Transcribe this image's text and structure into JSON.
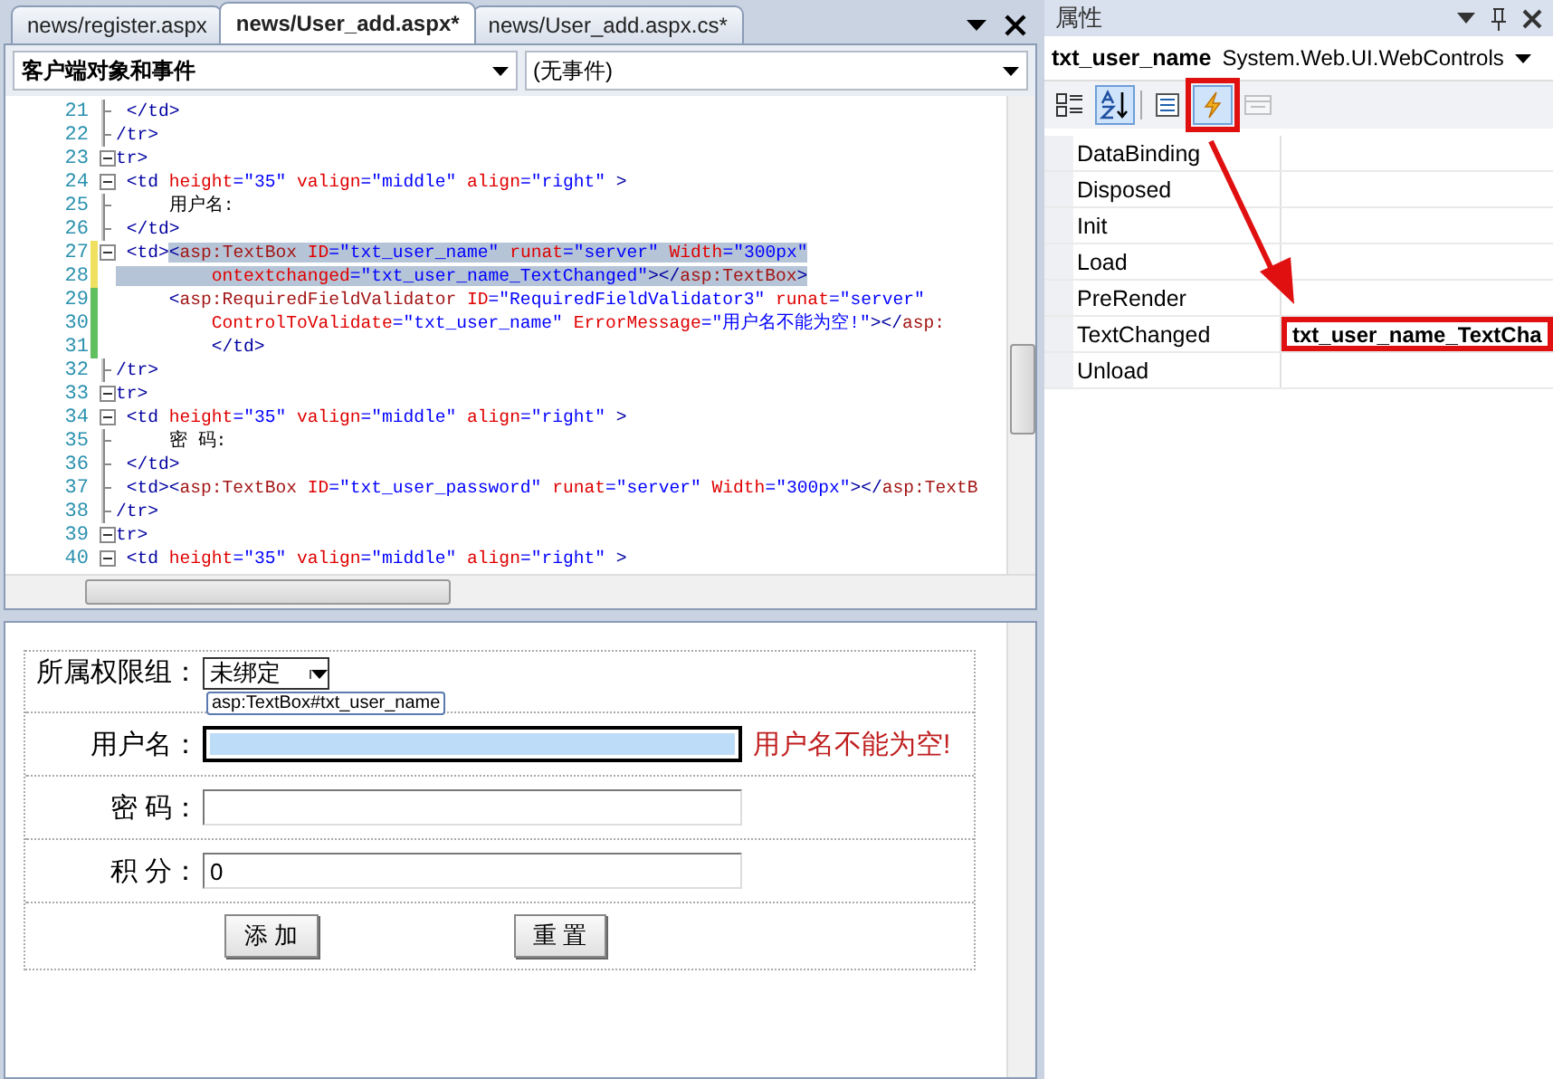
{
  "editor": {
    "tabs": [
      {
        "label": "news/register.aspx",
        "selected": false
      },
      {
        "label": "news/User_add.aspx*",
        "selected": true
      },
      {
        "label": "news/User_add.aspx.cs*",
        "selected": false
      }
    ],
    "object_dropdown": "客户端对象和事件",
    "event_dropdown": "(无事件)",
    "code_lines": [
      {
        "number": "21",
        "collapsible": false,
        "guide": true,
        "edited": false,
        "saved": false,
        "tokens": [
          {
            "kind": "tag",
            "text": " </td>",
            "selected": false
          }
        ]
      },
      {
        "number": "22",
        "collapsible": false,
        "guide": true,
        "edited": false,
        "saved": false,
        "tokens": [
          {
            "kind": "tag",
            "text": "/tr>",
            "selected": false
          }
        ]
      },
      {
        "number": "23",
        "collapsible": true,
        "guide": false,
        "edited": false,
        "saved": false,
        "tokens": [
          {
            "kind": "tag",
            "text": "tr>",
            "selected": false
          }
        ]
      },
      {
        "number": "24",
        "collapsible": true,
        "guide": false,
        "edited": false,
        "saved": false,
        "tokens": [
          {
            "kind": "tag",
            "text": " <td ",
            "selected": false
          },
          {
            "kind": "attr",
            "text": "height",
            "selected": false
          },
          {
            "kind": "value",
            "text": "=\"35\" ",
            "selected": false
          },
          {
            "kind": "attr",
            "text": "valign",
            "selected": false
          },
          {
            "kind": "value",
            "text": "=\"middle\" ",
            "selected": false
          },
          {
            "kind": "attr",
            "text": "align",
            "selected": false
          },
          {
            "kind": "value",
            "text": "=\"right\" ",
            "selected": false
          },
          {
            "kind": "tag",
            "text": ">",
            "selected": false
          }
        ]
      },
      {
        "number": "25",
        "collapsible": false,
        "guide": true,
        "edited": false,
        "saved": false,
        "tokens": [
          {
            "kind": "text",
            "text": "     用户名:",
            "selected": false
          }
        ]
      },
      {
        "number": "26",
        "collapsible": false,
        "guide": true,
        "edited": false,
        "saved": false,
        "tokens": [
          {
            "kind": "tag",
            "text": " </td>",
            "selected": false
          }
        ]
      },
      {
        "number": "27",
        "collapsible": true,
        "guide": false,
        "edited": true,
        "saved": false,
        "tokens": [
          {
            "kind": "tag",
            "text": " <td>",
            "selected": false
          },
          {
            "kind": "tag",
            "text": "<",
            "selected": true
          },
          {
            "kind": "asp",
            "text": "asp:TextBox ",
            "selected": true
          },
          {
            "kind": "attr",
            "text": "ID",
            "selected": true
          },
          {
            "kind": "value",
            "text": "=\"txt_user_name\" ",
            "selected": true
          },
          {
            "kind": "attr",
            "text": "runat",
            "selected": true
          },
          {
            "kind": "value",
            "text": "=\"server\" ",
            "selected": true
          },
          {
            "kind": "attr",
            "text": "Width",
            "selected": true
          },
          {
            "kind": "value",
            "text": "=\"300px\"",
            "selected": true
          }
        ]
      },
      {
        "number": "28",
        "collapsible": false,
        "guide": false,
        "edited": true,
        "saved": false,
        "tokens": [
          {
            "kind": "attr",
            "text": "         ontextchanged",
            "selected": true
          },
          {
            "kind": "value",
            "text": "=\"txt_user_name_TextChanged\"",
            "selected": true
          },
          {
            "kind": "tag",
            "text": "></",
            "selected": true
          },
          {
            "kind": "asp",
            "text": "asp:TextBox",
            "selected": true
          },
          {
            "kind": "tag",
            "text": ">",
            "selected": true
          }
        ]
      },
      {
        "number": "29",
        "collapsible": false,
        "guide": false,
        "edited": false,
        "saved": true,
        "tokens": [
          {
            "kind": "tag",
            "text": "     <",
            "selected": false
          },
          {
            "kind": "asp",
            "text": "asp:RequiredFieldValidator ",
            "selected": false
          },
          {
            "kind": "attr",
            "text": "ID",
            "selected": false
          },
          {
            "kind": "value",
            "text": "=\"RequiredFieldValidator3\" ",
            "selected": false
          },
          {
            "kind": "attr",
            "text": "runat",
            "selected": false
          },
          {
            "kind": "value",
            "text": "=\"server\"",
            "selected": false
          }
        ]
      },
      {
        "number": "30",
        "collapsible": false,
        "guide": false,
        "edited": false,
        "saved": true,
        "tokens": [
          {
            "kind": "attr",
            "text": "         ControlToValidate",
            "selected": false
          },
          {
            "kind": "value",
            "text": "=\"txt_user_name\" ",
            "selected": false
          },
          {
            "kind": "attr",
            "text": "ErrorMessage",
            "selected": false
          },
          {
            "kind": "value",
            "text": "=\"用户名不能为空!\"",
            "selected": false
          },
          {
            "kind": "tag",
            "text": "></",
            "selected": false
          },
          {
            "kind": "asp",
            "text": "asp:",
            "selected": false
          }
        ]
      },
      {
        "number": "31",
        "collapsible": false,
        "guide": false,
        "edited": false,
        "saved": true,
        "tokens": [
          {
            "kind": "tag",
            "text": "         </td>",
            "selected": false
          }
        ]
      },
      {
        "number": "32",
        "collapsible": false,
        "guide": true,
        "edited": false,
        "saved": false,
        "tokens": [
          {
            "kind": "tag",
            "text": "/tr>",
            "selected": false
          }
        ]
      },
      {
        "number": "33",
        "collapsible": true,
        "guide": false,
        "edited": false,
        "saved": false,
        "tokens": [
          {
            "kind": "tag",
            "text": "tr>",
            "selected": false
          }
        ]
      },
      {
        "number": "34",
        "collapsible": true,
        "guide": false,
        "edited": false,
        "saved": false,
        "tokens": [
          {
            "kind": "tag",
            "text": " <td ",
            "selected": false
          },
          {
            "kind": "attr",
            "text": "height",
            "selected": false
          },
          {
            "kind": "value",
            "text": "=\"35\" ",
            "selected": false
          },
          {
            "kind": "attr",
            "text": "valign",
            "selected": false
          },
          {
            "kind": "value",
            "text": "=\"middle\" ",
            "selected": false
          },
          {
            "kind": "attr",
            "text": "align",
            "selected": false
          },
          {
            "kind": "value",
            "text": "=\"right\" ",
            "selected": false
          },
          {
            "kind": "tag",
            "text": ">",
            "selected": false
          }
        ]
      },
      {
        "number": "35",
        "collapsible": false,
        "guide": true,
        "edited": false,
        "saved": false,
        "tokens": [
          {
            "kind": "text",
            "text": "     密 码:",
            "selected": false
          }
        ]
      },
      {
        "number": "36",
        "collapsible": false,
        "guide": true,
        "edited": false,
        "saved": false,
        "tokens": [
          {
            "kind": "tag",
            "text": " </td>",
            "selected": false
          }
        ]
      },
      {
        "number": "37",
        "collapsible": false,
        "guide": true,
        "edited": false,
        "saved": false,
        "tokens": [
          {
            "kind": "tag",
            "text": " <td><",
            "selected": false
          },
          {
            "kind": "asp",
            "text": "asp:TextBox ",
            "selected": false
          },
          {
            "kind": "attr",
            "text": "ID",
            "selected": false
          },
          {
            "kind": "value",
            "text": "=\"txt_user_password\" ",
            "selected": false
          },
          {
            "kind": "attr",
            "text": "runat",
            "selected": false
          },
          {
            "kind": "value",
            "text": "=\"server\" ",
            "selected": false
          },
          {
            "kind": "attr",
            "text": "Width",
            "selected": false
          },
          {
            "kind": "value",
            "text": "=\"300px\"",
            "selected": false
          },
          {
            "kind": "tag",
            "text": "></",
            "selected": false
          },
          {
            "kind": "asp",
            "text": "asp:TextB",
            "selected": false
          }
        ]
      },
      {
        "number": "38",
        "collapsible": false,
        "guide": true,
        "edited": false,
        "saved": false,
        "tokens": [
          {
            "kind": "tag",
            "text": "/tr>",
            "selected": false
          }
        ]
      },
      {
        "number": "39",
        "collapsible": true,
        "guide": false,
        "edited": false,
        "saved": false,
        "tokens": [
          {
            "kind": "tag",
            "text": "tr>",
            "selected": false
          }
        ]
      },
      {
        "number": "40",
        "collapsible": true,
        "guide": false,
        "edited": false,
        "saved": false,
        "tokens": [
          {
            "kind": "tag",
            "text": " <td ",
            "selected": false
          },
          {
            "kind": "attr",
            "text": "height",
            "selected": false
          },
          {
            "kind": "value",
            "text": "=\"35\" ",
            "selected": false
          },
          {
            "kind": "attr",
            "text": "valign",
            "selected": false
          },
          {
            "kind": "value",
            "text": "=\"middle\" ",
            "selected": false
          },
          {
            "kind": "attr",
            "text": "align",
            "selected": false
          },
          {
            "kind": "value",
            "text": "=\"right\" ",
            "selected": false
          },
          {
            "kind": "tag",
            "text": ">",
            "selected": false
          }
        ]
      }
    ]
  },
  "designer": {
    "control_tag": "asp:TextBox#txt_user_name",
    "rows": [
      {
        "label": "所属权限组：",
        "kind": "select",
        "value": "未绑定",
        "selected": false
      },
      {
        "label": "用户名：",
        "kind": "text",
        "value": "",
        "selected": true,
        "error": "用户名不能为空!"
      },
      {
        "label": "密 码：",
        "kind": "text",
        "value": "",
        "selected": false
      },
      {
        "label": "积 分：",
        "kind": "text",
        "value": "0",
        "selected": false
      }
    ],
    "buttons": [
      "添 加",
      "重 置"
    ]
  },
  "properties": {
    "title": "属性",
    "object_name": "txt_user_name",
    "object_type": "System.Web.UI.WebControls",
    "toolbar": [
      {
        "kind": "categorized",
        "selected": false,
        "disabled": false,
        "highlighted": false
      },
      {
        "kind": "alphabetical",
        "selected": true,
        "disabled": false,
        "highlighted": false
      },
      {
        "kind": "properties",
        "selected": false,
        "disabled": false,
        "highlighted": false
      },
      {
        "kind": "events",
        "selected": true,
        "disabled": false,
        "highlighted": true
      },
      {
        "kind": "pages",
        "selected": false,
        "disabled": true,
        "highlighted": false
      }
    ],
    "events": [
      {
        "name": "DataBinding",
        "highlighted": false
      },
      {
        "name": "Disposed",
        "highlighted": false
      },
      {
        "name": "Init",
        "highlighted": false
      },
      {
        "name": "Load",
        "highlighted": false
      },
      {
        "name": "PreRender",
        "highlighted": false
      },
      {
        "name": "TextChanged",
        "value": "txt_user_name_TextCha",
        "highlighted": true
      },
      {
        "name": "Unload",
        "highlighted": false
      }
    ]
  }
}
